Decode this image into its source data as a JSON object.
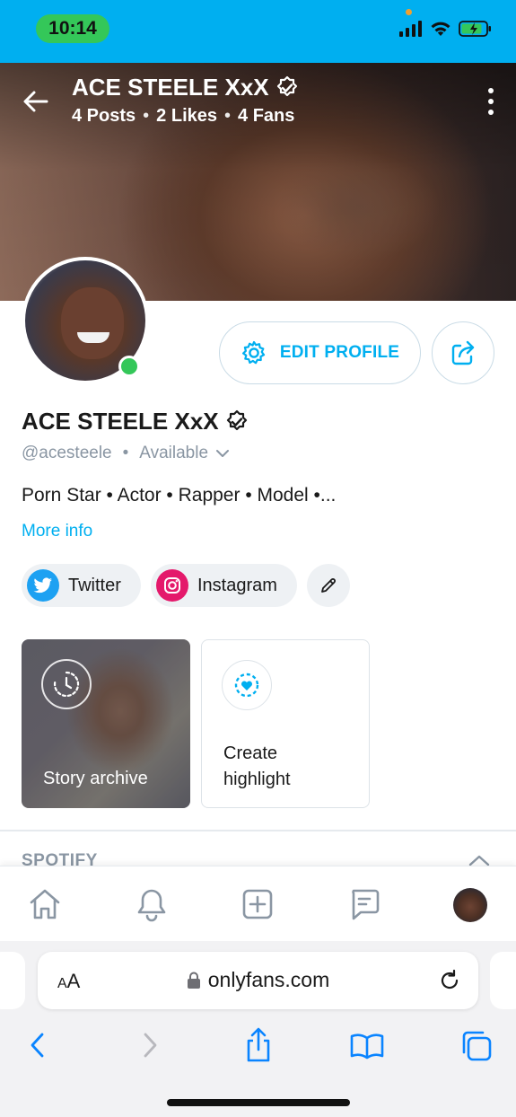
{
  "status_bar": {
    "time": "10:14"
  },
  "profile": {
    "name": "ACE STEELE XxX",
    "stats": {
      "posts": "4 Posts",
      "likes": "2 Likes",
      "fans": "4 Fans"
    },
    "handle": "@acesteele",
    "availability": "Available",
    "bio": "Porn Star • Actor • Rapper • Model •...",
    "more_info_label": "More info",
    "edit_profile_label": "EDIT PROFILE"
  },
  "social_links": [
    {
      "label": "Twitter",
      "icon": "twitter-icon"
    },
    {
      "label": "Instagram",
      "icon": "instagram-icon"
    }
  ],
  "highlights": {
    "story_archive_label": "Story archive",
    "create_highlight_label": "Create highlight"
  },
  "sections": {
    "spotify_label": "SPOTIFY"
  },
  "app_nav": {
    "items": [
      "home-icon",
      "bell-icon",
      "add-post-icon",
      "messages-icon",
      "profile-avatar"
    ]
  },
  "browser": {
    "text_size_label": "AA",
    "url": "onlyfans.com"
  },
  "colors": {
    "brand": "#00aff0",
    "status_bar": "#00aff0",
    "online": "#34c759",
    "twitter": "#1da1f2",
    "instagram": "#e4196b"
  }
}
